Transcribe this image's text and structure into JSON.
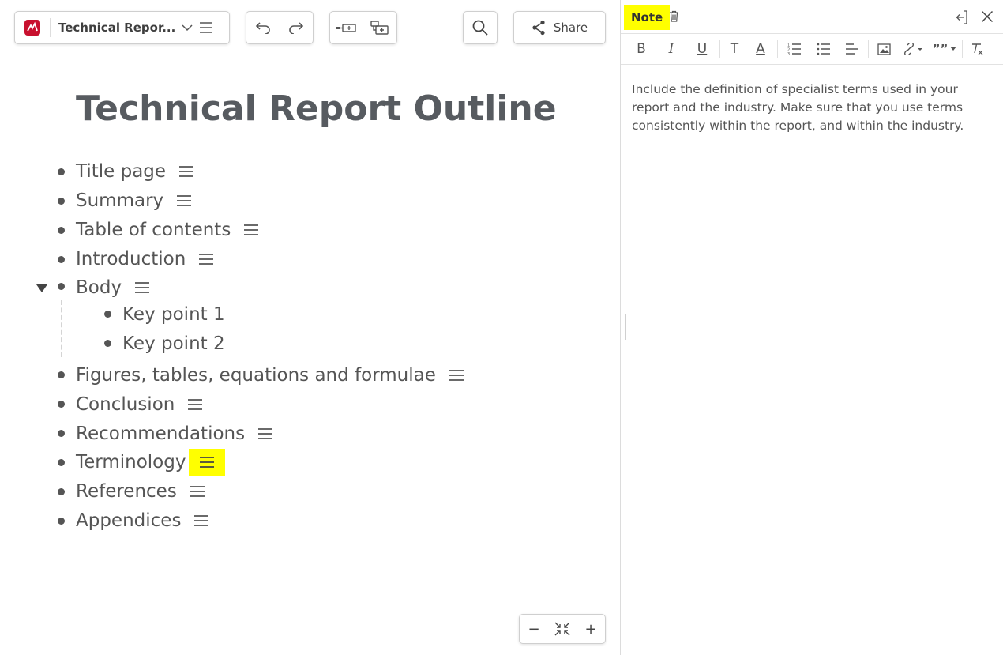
{
  "toolbar": {
    "doc_title": "Technical Repor...",
    "share_label": "Share"
  },
  "map": {
    "title": "Technical Report Outline",
    "topics": [
      {
        "label": "Title page"
      },
      {
        "label": "Summary"
      },
      {
        "label": "Table of contents"
      },
      {
        "label": "Introduction"
      },
      {
        "label": "Body",
        "expanded": true
      },
      {
        "label": "Figures, tables, equations and formulae"
      },
      {
        "label": "Conclusion"
      },
      {
        "label": "Recommendations"
      },
      {
        "label": "Terminology",
        "selected": true
      },
      {
        "label": "References"
      },
      {
        "label": "Appendices"
      }
    ],
    "subtopics": [
      {
        "label": "Key point 1"
      },
      {
        "label": "Key point 2"
      }
    ]
  },
  "note_panel": {
    "title": "Note",
    "body": "Include the definition of specialist terms used in your report and the industry. Make sure that you use terms consistently within the report, and within the industry.",
    "format_buttons": {
      "bold": "B",
      "italic": "I",
      "underline": "U",
      "text": "T",
      "font_color": "A",
      "quote": "””"
    }
  },
  "zoom": {
    "out": "−",
    "in": "+"
  },
  "colors": {
    "highlight": "#ffff00",
    "brand": "#c8102e"
  }
}
